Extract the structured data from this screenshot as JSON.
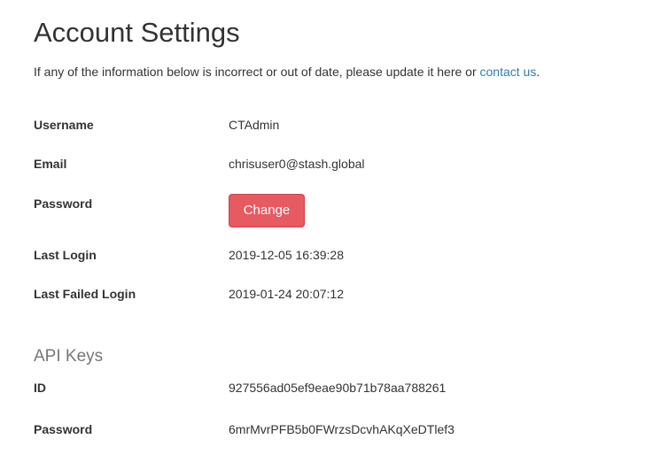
{
  "page": {
    "title": "Account Settings",
    "intro_text": "If any of the information below is incorrect or out of date, please update it here or ",
    "contact_link": "contact us",
    "intro_suffix": "."
  },
  "account": {
    "username_label": "Username",
    "username_value": "CTAdmin",
    "email_label": "Email",
    "email_value": "chrisuser0@stash.global",
    "password_label": "Password",
    "change_button": "Change",
    "last_login_label": "Last Login",
    "last_login_value": "2019-12-05 16:39:28",
    "last_failed_login_label": "Last Failed Login",
    "last_failed_login_value": "2019-01-24 20:07:12"
  },
  "api_keys": {
    "heading": "API Keys",
    "id_label": "ID",
    "id_value": "927556ad05ef9eae90b71b78aa788261",
    "password_label": "Password",
    "password_value": "6mrMvrPFB5b0FWrzsDcvhAKqXeDTlef3"
  },
  "colors": {
    "link": "#337ab7",
    "danger_button": "#e65a62",
    "muted_heading": "#777777",
    "text": "#333333"
  }
}
